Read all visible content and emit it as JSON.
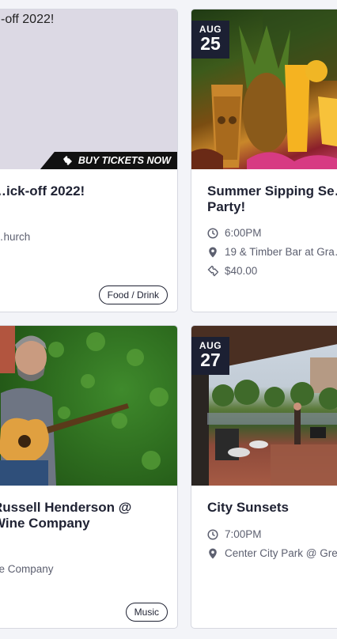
{
  "cards": [
    {
      "title": "…ick-off 2022!",
      "image_text": "-off 2022!",
      "buy_label": "BUY TICKETS NOW",
      "location": "…hurch",
      "tag": "Food / Drink"
    },
    {
      "date_month": "AUG",
      "date_day": "25",
      "title_line1": "Summer Sipping Se…",
      "title_line2": "Party!",
      "time": "6:00PM",
      "location": "19 & Timber Bar at Gra…",
      "price": "$40.00"
    },
    {
      "title_line1": "Russell Henderson @",
      "title_line2": "Wine Company",
      "location": "ne Company",
      "tag": "Music"
    },
    {
      "date_month": "AUG",
      "date_day": "27",
      "title": "City Sunsets",
      "time": "7:00PM",
      "location": "Center City Park @ Gre…"
    }
  ],
  "icons": {
    "clock": "clock-icon",
    "pin": "map-pin-icon",
    "ticket": "ticket-icon"
  },
  "colors": {
    "date_badge": "#1c2033",
    "title": "#1f2233",
    "meta": "#5d6070"
  }
}
